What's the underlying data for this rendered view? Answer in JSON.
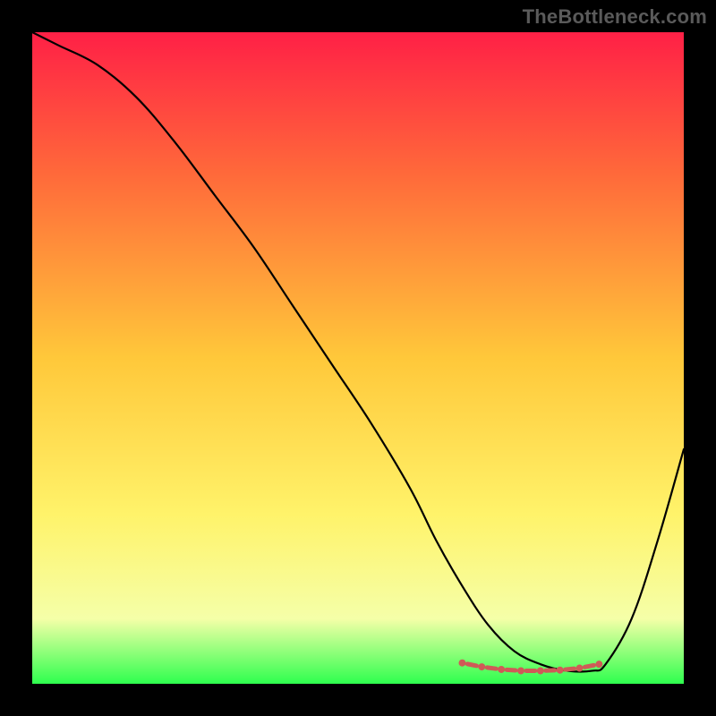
{
  "watermark": "TheBottleneck.com",
  "colors": {
    "background": "#000000",
    "gradient_top": "#ff2046",
    "gradient_mid_upper": "#ff6a3a",
    "gradient_mid": "#ffc83a",
    "gradient_mid_lower": "#fff36a",
    "gradient_low": "#f5ffa8",
    "gradient_bottom": "#2eff4e",
    "curve": "#000000",
    "marker": "#cf5b57"
  },
  "chart_data": {
    "type": "line",
    "title": "",
    "xlabel": "",
    "ylabel": "",
    "xlim": [
      0,
      100
    ],
    "ylim": [
      0,
      100
    ],
    "series": [
      {
        "name": "bottleneck-curve",
        "x": [
          0,
          4,
          10,
          16,
          22,
          28,
          34,
          40,
          46,
          52,
          58,
          62,
          66,
          70,
          74,
          78,
          82,
          86,
          88,
          92,
          96,
          100
        ],
        "y": [
          100,
          98,
          95,
          90,
          83,
          75,
          67,
          58,
          49,
          40,
          30,
          22,
          15,
          9,
          5,
          3,
          2,
          2,
          3,
          10,
          22,
          36
        ]
      }
    ],
    "annotations": [
      {
        "name": "optimal-markers",
        "style": "dash-dot",
        "x": [
          66,
          69,
          72,
          75,
          78,
          81,
          84,
          87
        ],
        "y": [
          3.2,
          2.6,
          2.2,
          2.0,
          2.0,
          2.1,
          2.4,
          3.0
        ]
      }
    ]
  }
}
